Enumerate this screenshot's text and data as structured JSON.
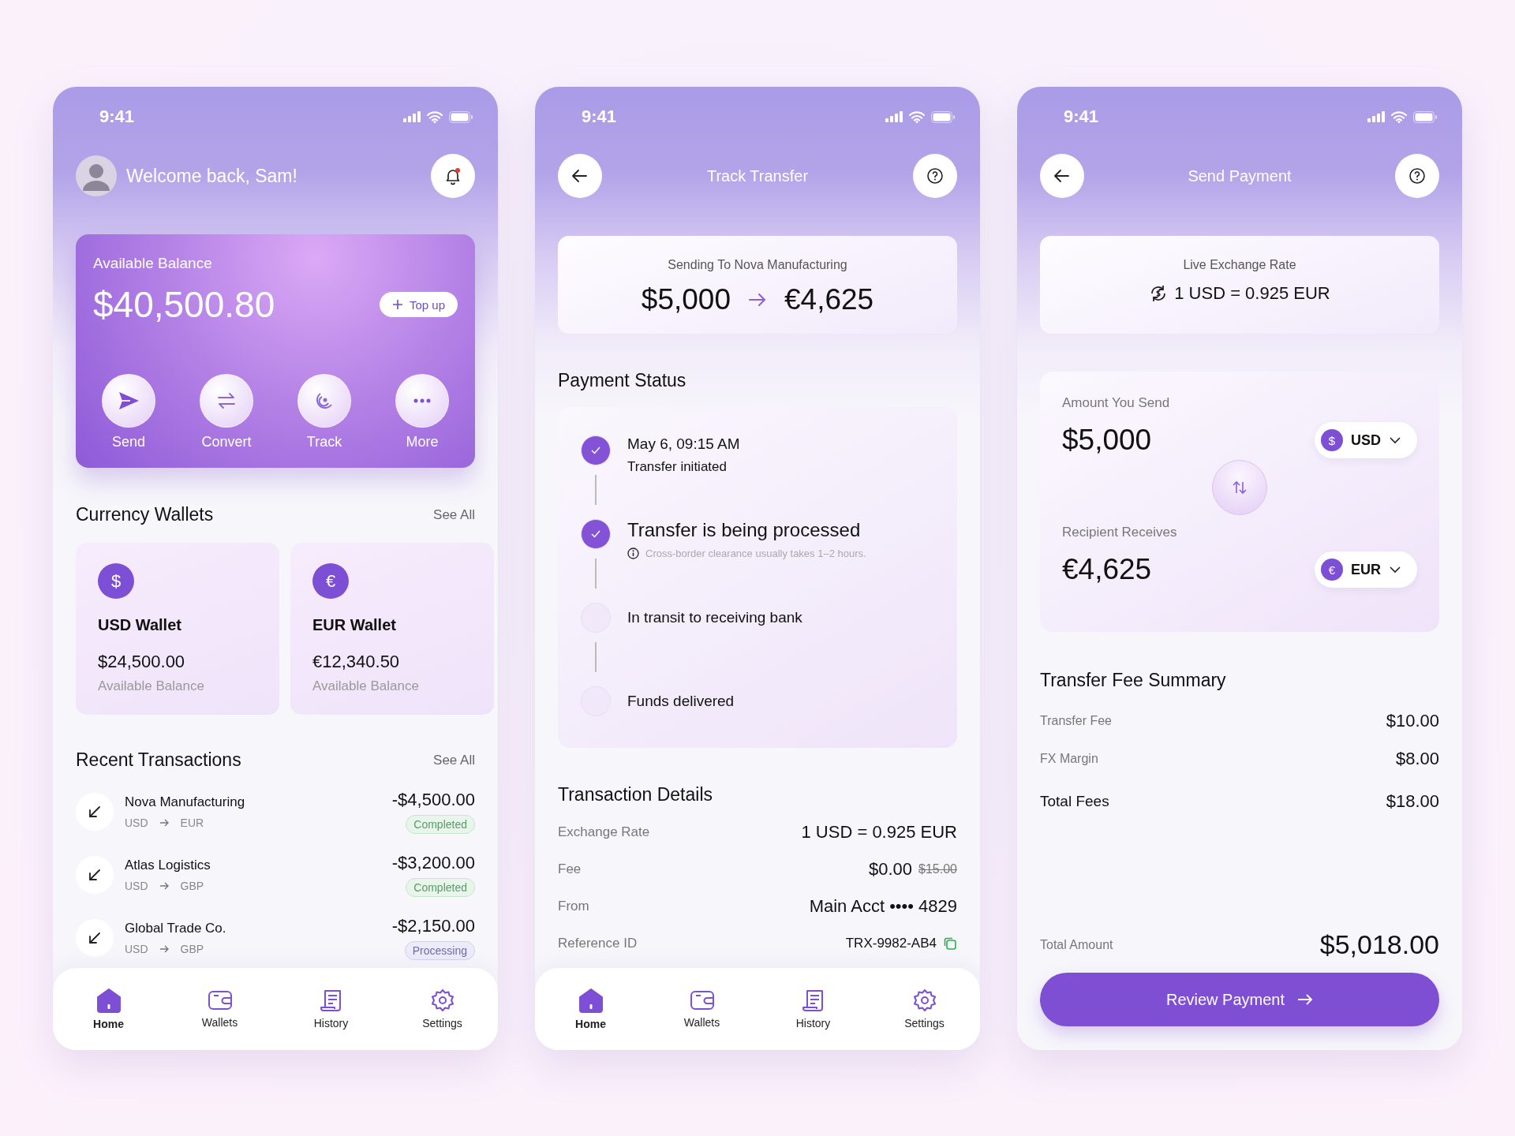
{
  "home": {
    "time": "9:41",
    "greeting": "Welcome back, Sam!",
    "balance": {
      "label": "Available Balance",
      "amount": "$40,500.80",
      "top_up": "Top up"
    },
    "actions": [
      {
        "kind": "send",
        "label": "Send"
      },
      {
        "kind": "convert",
        "label": "Convert"
      },
      {
        "kind": "track",
        "label": "Track"
      },
      {
        "kind": "more",
        "label": "More"
      }
    ],
    "wallets": {
      "title": "Currency Wallets",
      "see_all": "See All",
      "items": [
        {
          "symbol": "$",
          "name": "USD Wallet",
          "amount": "$24,500.00",
          "caption": "Available Balance"
        },
        {
          "symbol": "€",
          "name": "EUR Wallet",
          "amount": "€12,340.50",
          "caption": "Available Balance"
        }
      ]
    },
    "transactions": {
      "title": "Recent Transactions",
      "see_all": "See All",
      "items": [
        {
          "name": "Nova Manufacturing",
          "from": "USD",
          "to": "EUR",
          "amount": "-$4,500.00",
          "status": "Completed",
          "kind": "completed"
        },
        {
          "name": "Atlas Logistics",
          "from": "USD",
          "to": "GBP",
          "amount": "-$3,200.00",
          "status": "Completed",
          "kind": "completed"
        },
        {
          "name": "Global Trade Co.",
          "from": "USD",
          "to": "GBP",
          "amount": "-$2,150.00",
          "status": "Processing",
          "kind": "processing"
        }
      ]
    },
    "nav": [
      {
        "kind": "home",
        "label": "Home",
        "selected": true
      },
      {
        "kind": "wallet",
        "label": "Wallets",
        "selected": false
      },
      {
        "kind": "history",
        "label": "History",
        "selected": false
      },
      {
        "kind": "settings",
        "label": "Settings",
        "selected": false
      }
    ]
  },
  "track": {
    "time": "9:41",
    "title": "Track Transfer",
    "summary": {
      "label": "Sending To Nova Manufacturing",
      "amount_from": "$5,000",
      "amount_to": "€4,625"
    },
    "status": {
      "title": "Payment Status",
      "steps": [
        {
          "title": "May 6, 09:15 AM",
          "subtitle": "Transfer initiated",
          "done": true,
          "current": false
        },
        {
          "title": "Transfer is being processed",
          "note": "Cross-border clearance usually takes 1–2 hours.",
          "done": true,
          "current": true
        },
        {
          "title": "In transit to receiving bank",
          "done": false,
          "current": false
        },
        {
          "title": "Funds delivered",
          "done": false,
          "current": false
        }
      ]
    },
    "details": {
      "title": "Transaction Details",
      "rows": [
        {
          "kind": "plain",
          "label": "Exchange Rate",
          "value": "1 USD = 0.925 EUR"
        },
        {
          "kind": "discount",
          "label": "Fee",
          "value": "$0.00",
          "old_value": "$15.00"
        },
        {
          "kind": "plain",
          "label": "From",
          "value": "Main Acct •••• 4829"
        },
        {
          "kind": "reference",
          "label": "Reference ID",
          "value": "TRX-9982-AB4"
        }
      ]
    },
    "nav": [
      {
        "kind": "home",
        "label": "Home",
        "selected": true
      },
      {
        "kind": "wallet",
        "label": "Wallets",
        "selected": false
      },
      {
        "kind": "history",
        "label": "History",
        "selected": false
      },
      {
        "kind": "settings",
        "label": "Settings",
        "selected": false
      }
    ]
  },
  "send": {
    "time": "9:41",
    "title": "Send Payment",
    "rate": {
      "label": "Live Exchange Rate",
      "value": "1 USD = 0.925 EUR"
    },
    "converter": {
      "send_label": "Amount You Send",
      "send_amount": "$5,000",
      "send_symbol": "$",
      "send_code": "USD",
      "receive_label": "Recipient Receives",
      "receive_amount": "€4,625",
      "receive_symbol": "€",
      "receive_code": "EUR"
    },
    "fees": {
      "title": "Transfer Fee Summary",
      "rows": [
        {
          "kind": "item",
          "label": "Transfer Fee",
          "value": "$10.00"
        },
        {
          "kind": "item",
          "label": "FX Margin",
          "value": "$8.00"
        },
        {
          "kind": "total",
          "label": "Total Fees",
          "value": "$18.00"
        }
      ]
    },
    "total": {
      "label": "Total Amount",
      "amount": "$5,018.00"
    },
    "button": "Review Payment"
  }
}
